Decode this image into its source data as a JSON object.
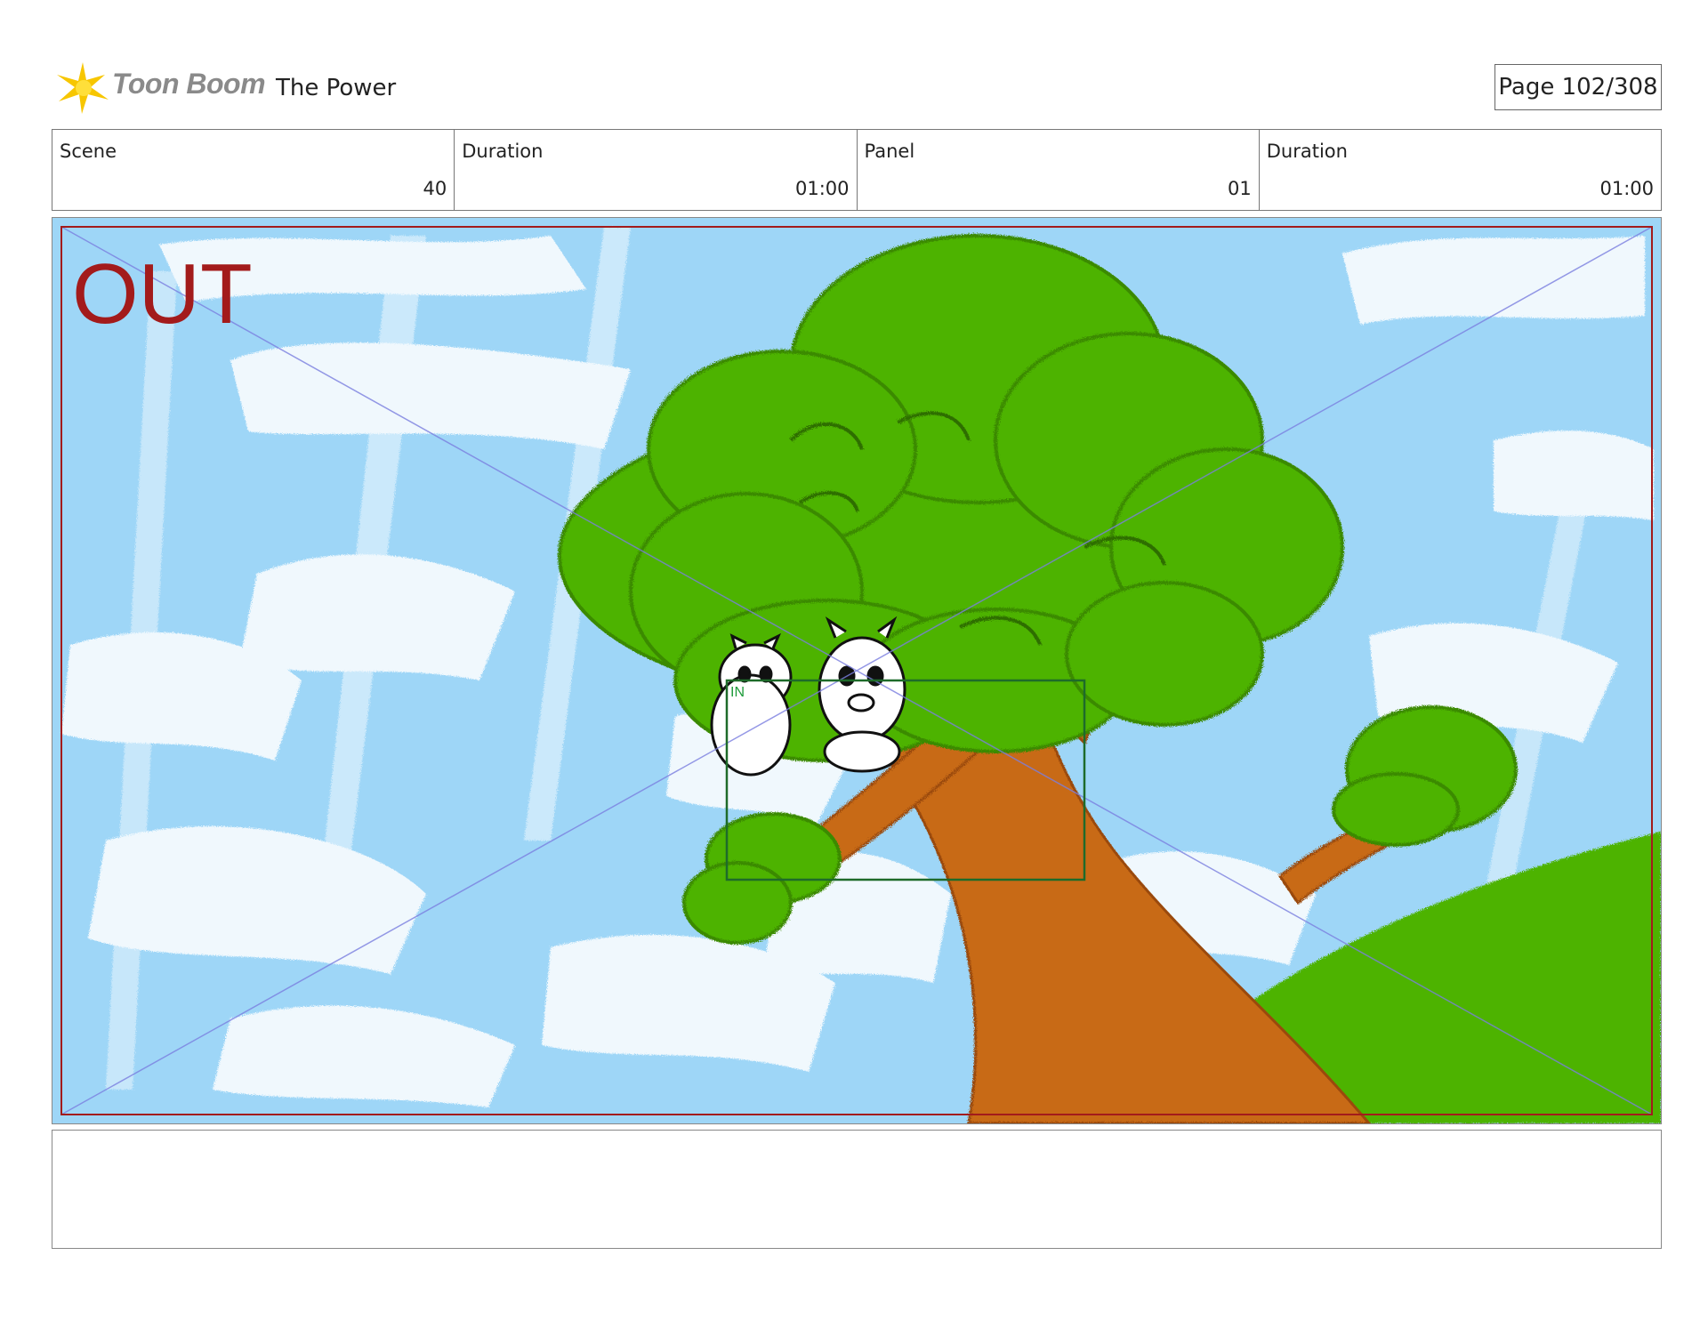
{
  "header": {
    "brand": "Toon Boom",
    "project_title": "The Power",
    "page_label": "Page 102/308"
  },
  "info": {
    "scene_label": "Scene",
    "scene_value": "40",
    "scene_duration_label": "Duration",
    "scene_duration_value": "01:00",
    "panel_label": "Panel",
    "panel_value": "01",
    "panel_duration_label": "Duration",
    "panel_duration_value": "01:00"
  },
  "panel": {
    "out_label": "OUT",
    "in_label": "IN",
    "colors": {
      "sky": "#9ed6f7",
      "cloud": "#ffffff",
      "foliage": "#4db300",
      "trunk": "#c86a14",
      "out_frame": "#a31b1b",
      "in_frame": "#1e6b2a"
    }
  },
  "icons": {
    "logo": "toon-boom-logo-icon"
  }
}
